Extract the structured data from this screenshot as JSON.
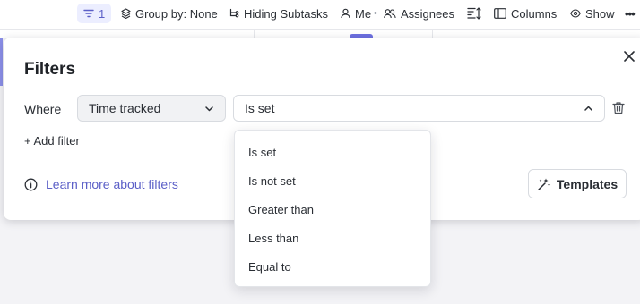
{
  "toolbar": {
    "filter_count": "1",
    "group_by": "Group by: None",
    "subtasks": "Hiding Subtasks",
    "me": "Me",
    "assignees": "Assignees",
    "columns": "Columns",
    "show": "Show",
    "separator": "•",
    "more": "•••"
  },
  "panel": {
    "title": "Filters",
    "where_label": "Where",
    "field_value": "Time tracked",
    "operator_value": "Is set",
    "add_filter": "+ Add filter",
    "learn_more": "Learn more about filters",
    "templates": "Templates"
  },
  "dropdown": {
    "options": [
      "Is set",
      "Is not set",
      "Greater than",
      "Less than",
      "Equal to"
    ]
  },
  "colors": {
    "accent": "#5b5fc7",
    "accent_bg": "#eceeff"
  }
}
